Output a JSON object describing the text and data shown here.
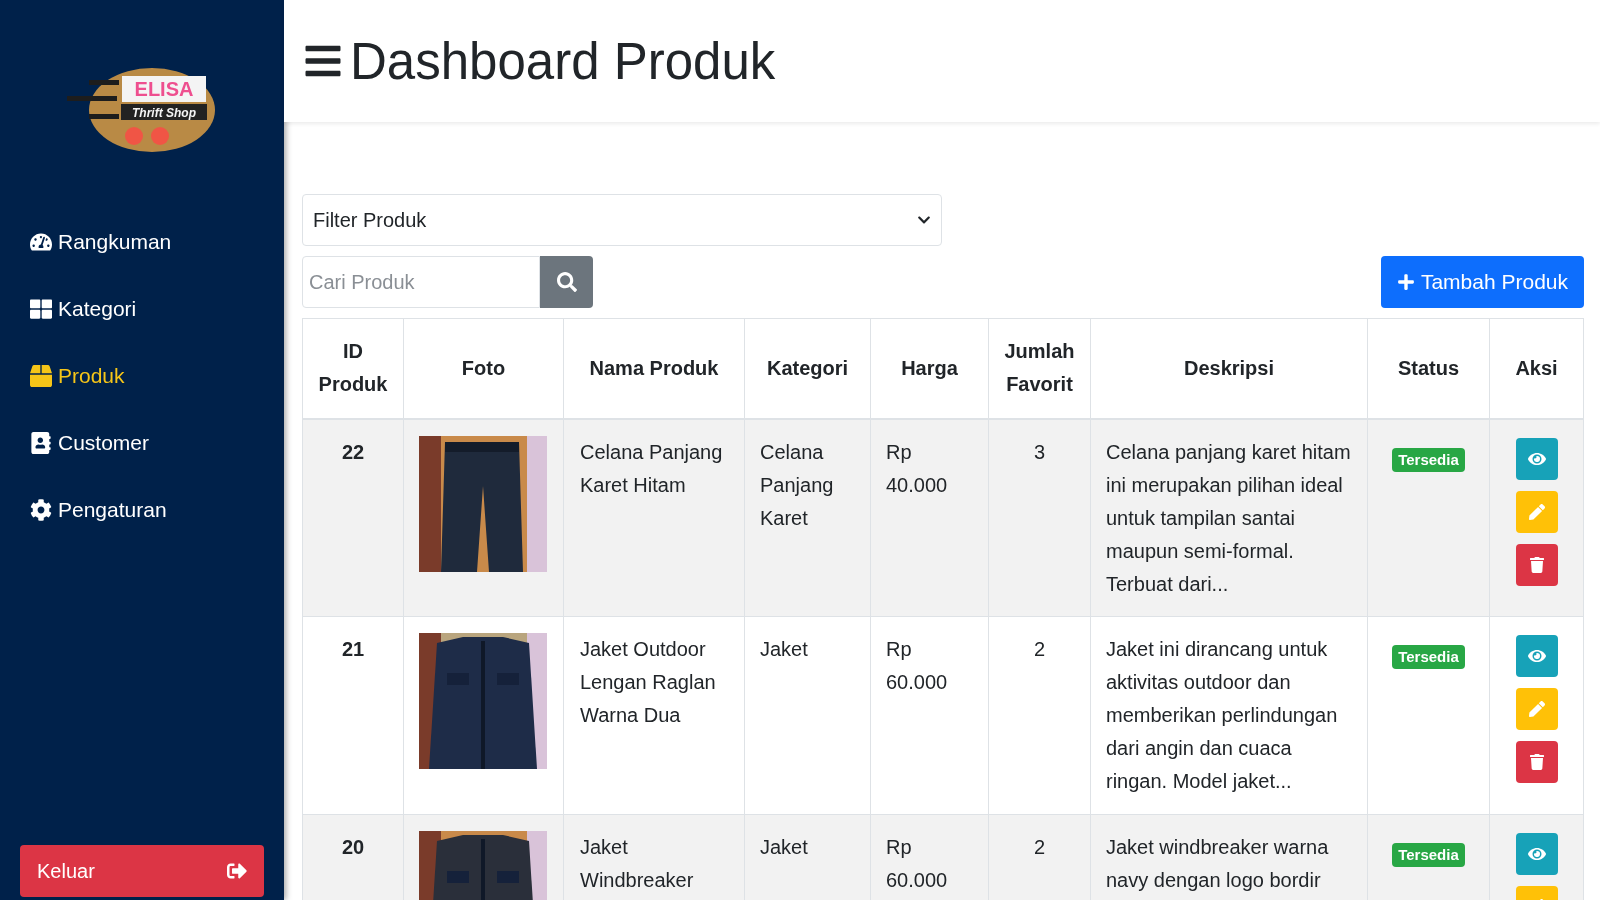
{
  "logo": {
    "name": "ELISA",
    "tagline": "Thrift Shop"
  },
  "sidebar": {
    "items": [
      {
        "label": "Rangkuman",
        "selected": false
      },
      {
        "label": "Kategori",
        "selected": false
      },
      {
        "label": "Produk",
        "selected": true
      },
      {
        "label": "Customer",
        "selected": false
      },
      {
        "label": "Pengaturan",
        "selected": false
      }
    ],
    "logout": "Keluar"
  },
  "header": {
    "title": "Dashboard Produk"
  },
  "filter": {
    "value": "Filter Produk"
  },
  "search": {
    "placeholder": "Cari Produk"
  },
  "add_button": "Tambah Produk",
  "table": {
    "columns": [
      "ID Produk",
      "Foto",
      "Nama Produk",
      "Kategori",
      "Harga",
      "Jumlah Favorit",
      "Deskripsi",
      "Status",
      "Aksi"
    ],
    "rows": [
      {
        "id": "22",
        "name": "Celana Panjang Karet Hitam",
        "category": "Celana Panjang Karet",
        "price": "Rp 40.000",
        "favorites": "3",
        "description": "Celana panjang karet hitam ini merupakan pilihan ideal untuk tampilan santai maupun semi-formal. Terbuat dari...",
        "status": "Tersedia",
        "actions": [
          {
            "kind": "view"
          },
          {
            "kind": "edit"
          },
          {
            "kind": "delete"
          }
        ]
      },
      {
        "id": "21",
        "name": "Jaket Outdoor Lengan Raglan Warna Dua",
        "category": "Jaket",
        "price": "Rp 60.000",
        "favorites": "2",
        "description": "Jaket ini dirancang untuk aktivitas outdoor dan memberikan perlindungan dari angin dan cuaca ringan. Model jaket...",
        "status": "Tersedia",
        "actions": [
          {
            "kind": "view"
          },
          {
            "kind": "edit"
          },
          {
            "kind": "delete"
          }
        ]
      },
      {
        "id": "20",
        "name": "Jaket Windbreaker",
        "category": "Jaket",
        "price": "Rp 60.000",
        "favorites": "2",
        "description": "Jaket windbreaker warna navy dengan logo bordir",
        "status": "Tersedia",
        "actions": [
          {
            "kind": "view"
          },
          {
            "kind": "edit"
          }
        ]
      }
    ]
  }
}
